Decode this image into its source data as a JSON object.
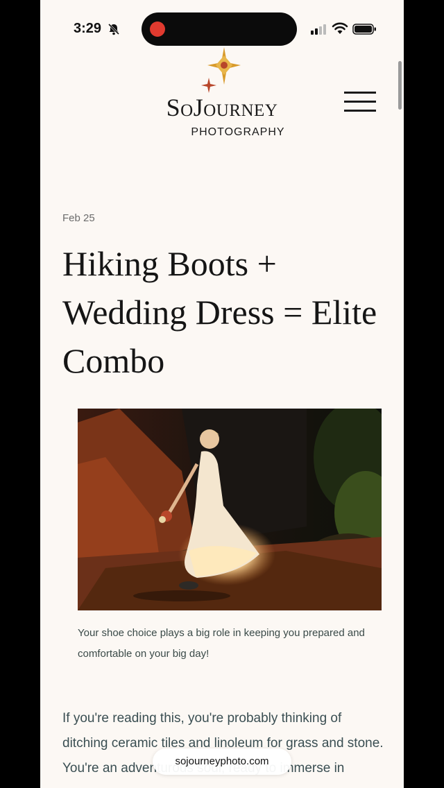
{
  "status_bar": {
    "time": "3:29"
  },
  "header": {
    "logo_name": "SoJourney",
    "logo_subtitle": "PHOTOGRAPHY",
    "menu_icon": "hamburger-icon"
  },
  "article": {
    "date": "Feb 25",
    "title": "Hiking Boots + Wedding Dress = Elite Combo",
    "image_caption": "Your shoe choice plays a big role in keeping you prepared and comfortable on your big day!",
    "body_intro": "If you're reading this, you're probably thinking of ditching ceramic tiles and linoleum for grass and stone. You're an adventurous soul, ready to immerse in"
  },
  "browser": {
    "url": "sojourneyphoto.com"
  },
  "colors": {
    "page_background": "#fcf8f4",
    "logo_gold": "#d89a2a",
    "logo_red": "#b8462a",
    "record_dot": "#e03a2f"
  }
}
